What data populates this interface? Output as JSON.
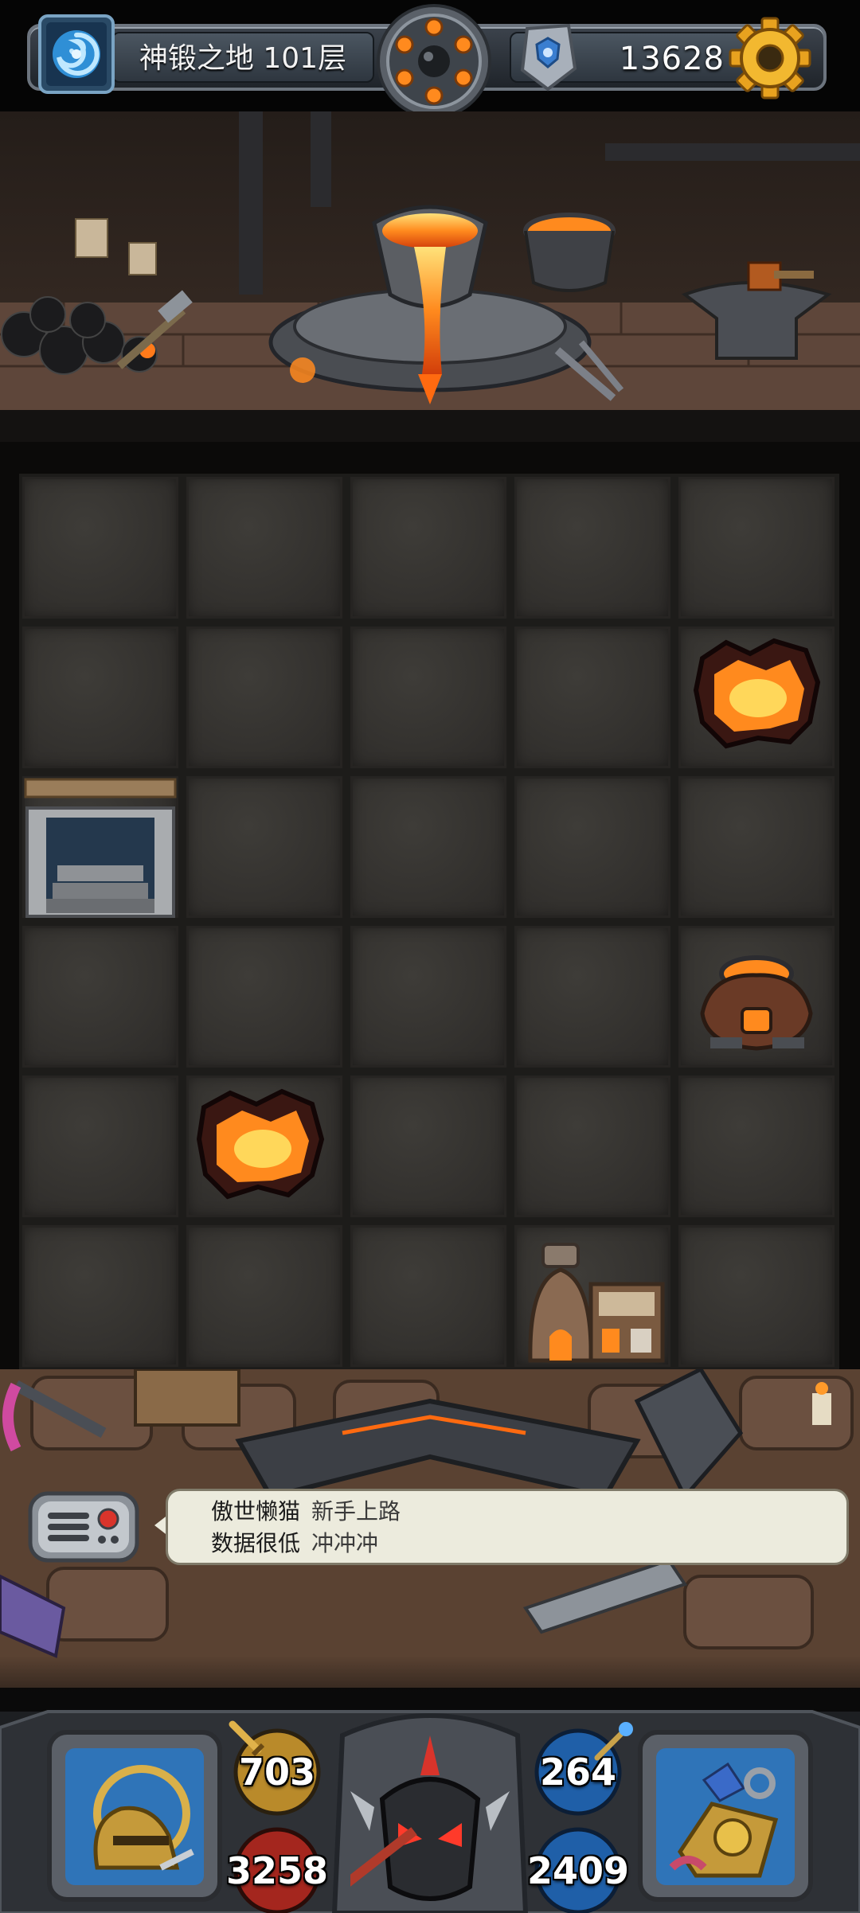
{
  "topbar": {
    "floor_title": "神锻之地 101层",
    "coins": "13628",
    "portal_icon": "swirl-portal-icon",
    "bomb_icon": "bomb-revolver-icon",
    "rune_icon": "rune-stone-icon",
    "settings_icon": "gear-icon"
  },
  "buffs": [
    {
      "icon": "armor-buff-icon"
    },
    {
      "icon": "golden-beast-buff-icon"
    },
    {
      "icon": "green-creature-buff-icon"
    },
    {
      "icon": "monkey-buff-icon"
    }
  ],
  "colors": {
    "lava": "#ff8a1e",
    "ring_red": "#d9342b",
    "ring_grey": "#7d848c",
    "chat_bg": "#ecebdd"
  },
  "chat": {
    "line1_name": "傲世懒猫",
    "line1_msg": "新手上路",
    "line2_name": "数据很低",
    "line2_msg": "冲冲冲"
  },
  "hud": {
    "attack": "703",
    "hp": "3258",
    "defense": "264",
    "mp": "2409",
    "hero_icon": "knight-helmet-icon",
    "boss_icon": "demon-helmet-icon",
    "bag_icon": "treasure-bag-icon"
  }
}
